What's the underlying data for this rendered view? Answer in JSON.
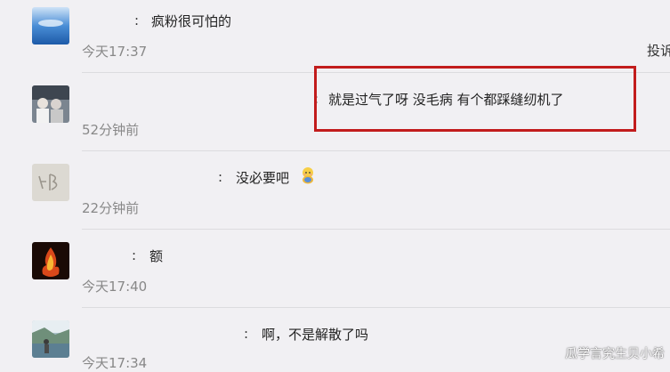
{
  "comments": [
    {
      "colon": ":",
      "text": "疯粉很可怕的",
      "time": "今天17:37",
      "report": "投诉"
    },
    {
      "colon": ":",
      "text": "就是过气了呀 没毛病 有个都踩缝纫机了",
      "time": "52分钟前"
    },
    {
      "colon": ":",
      "text": "没必要吧",
      "time": "22分钟前",
      "emoji": "bashful-emoji-icon"
    },
    {
      "colon": ":",
      "text": "额",
      "time": "今天17:40"
    },
    {
      "colon": ":",
      "text": "啊，不是解散了吗",
      "time": "今天17:34"
    }
  ],
  "watermark": "瓜学言究生贝小希",
  "colors": {
    "highlight": "#c21c1c",
    "background": "#f1f0f3",
    "time": "#888888"
  }
}
